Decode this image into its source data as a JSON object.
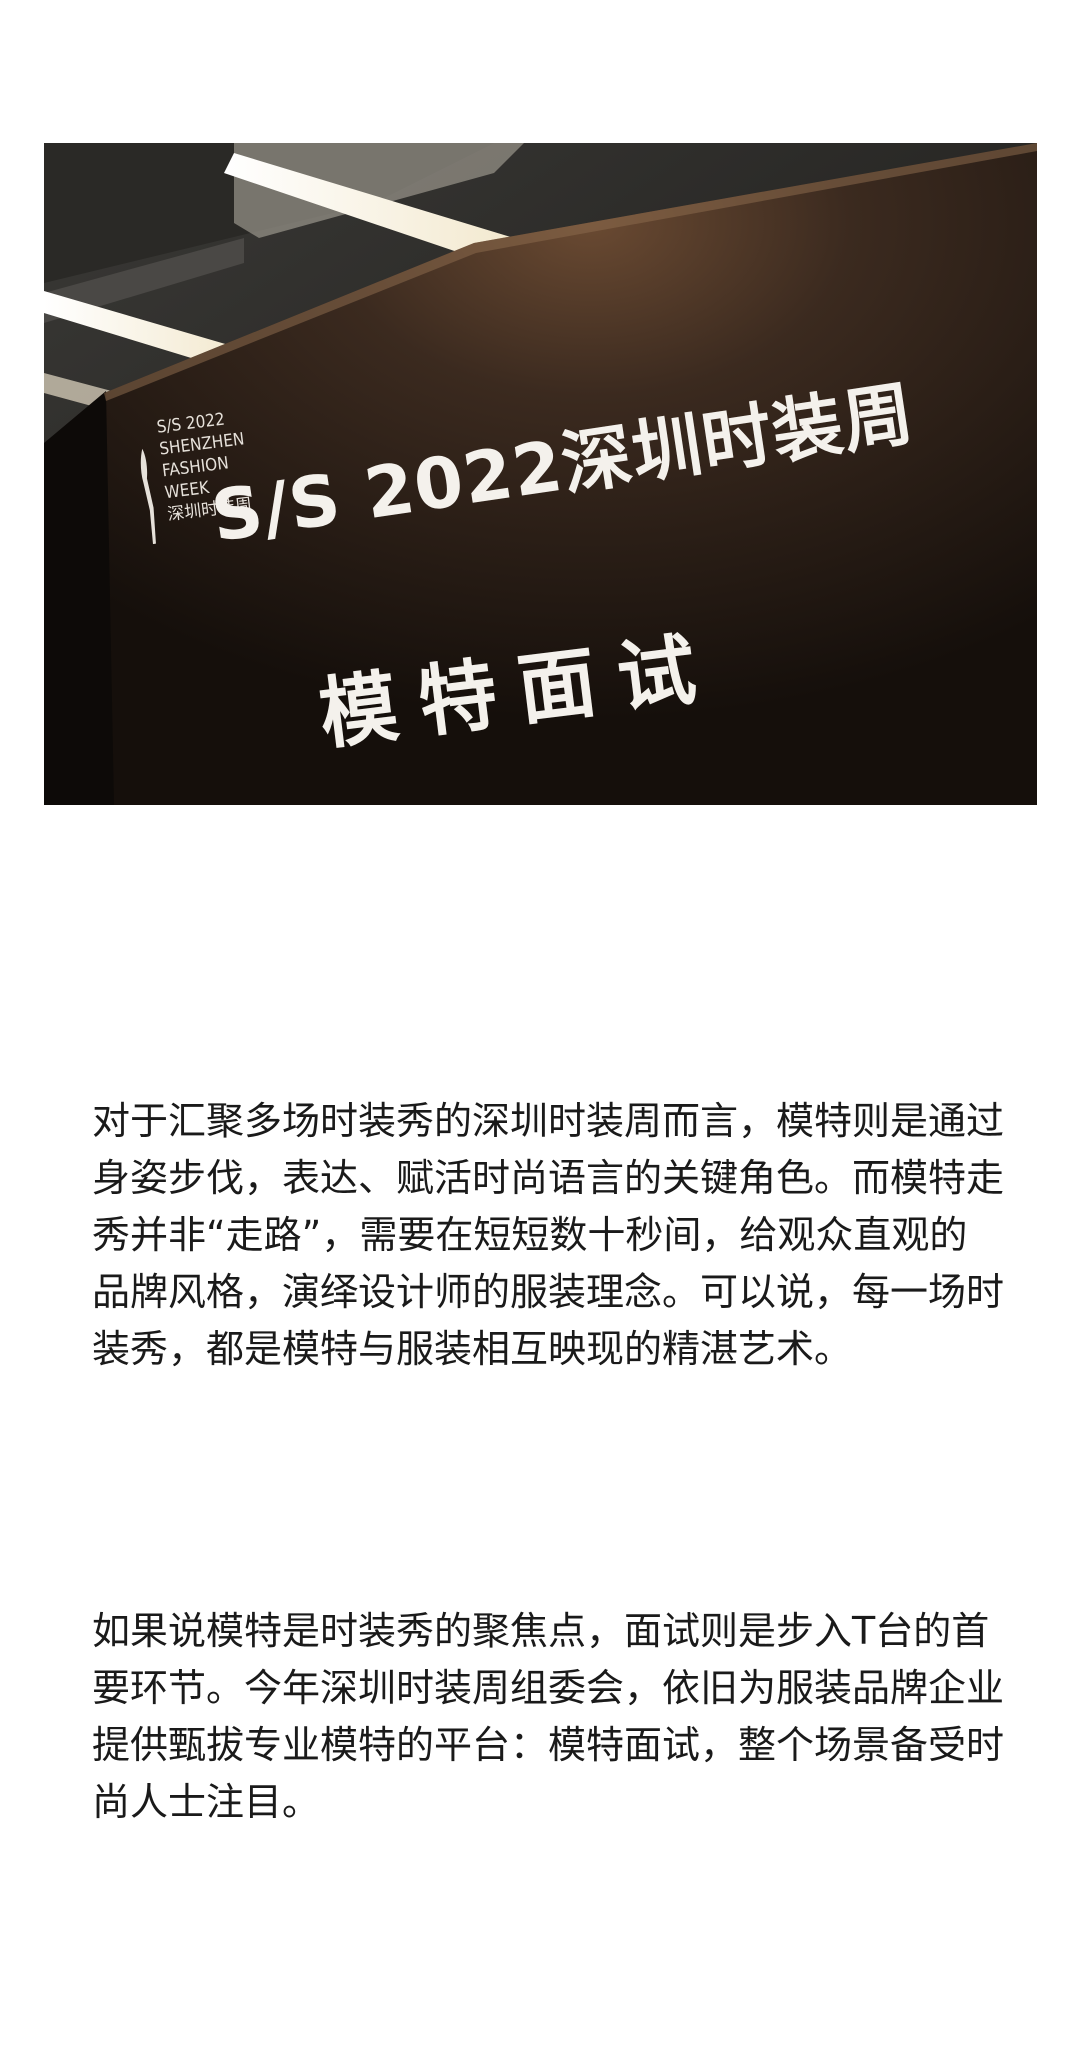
{
  "hero": {
    "logo_lines": [
      "S/S 2022",
      "SHENZHEN",
      "FASHION",
      "WEEK",
      "深圳时装周"
    ],
    "wall_title": "S/S 2022深圳时装周",
    "wall_subtitle": "模特面试"
  },
  "article": {
    "paragraphs": [
      "对于汇聚多场时装秀的深圳时装周而言，模特则是通过身姿步伐，表达、赋活时尚语言的关键角色。而模特走秀并非“走路”，需要在短短数十秒间，给观众直观的品牌风格，演绎设计师的服装理念。可以说，每一场时装秀，都是模特与服装相互映现的精湛艺术。",
      "如果说模特是时装秀的聚焦点，面试则是步入T台的首要环节。今年深圳时装周组委会，依旧为服装品牌企业提供甄拔专业模特的平台：模特面试，整个场景备受时尚人士注目。"
    ]
  },
  "colors": {
    "wall": "#231913",
    "wall_text": "#f4f1ec",
    "ceiling_light": "#fbf6e8",
    "body_text": "#1a1a1a",
    "background": "#ffffff"
  }
}
